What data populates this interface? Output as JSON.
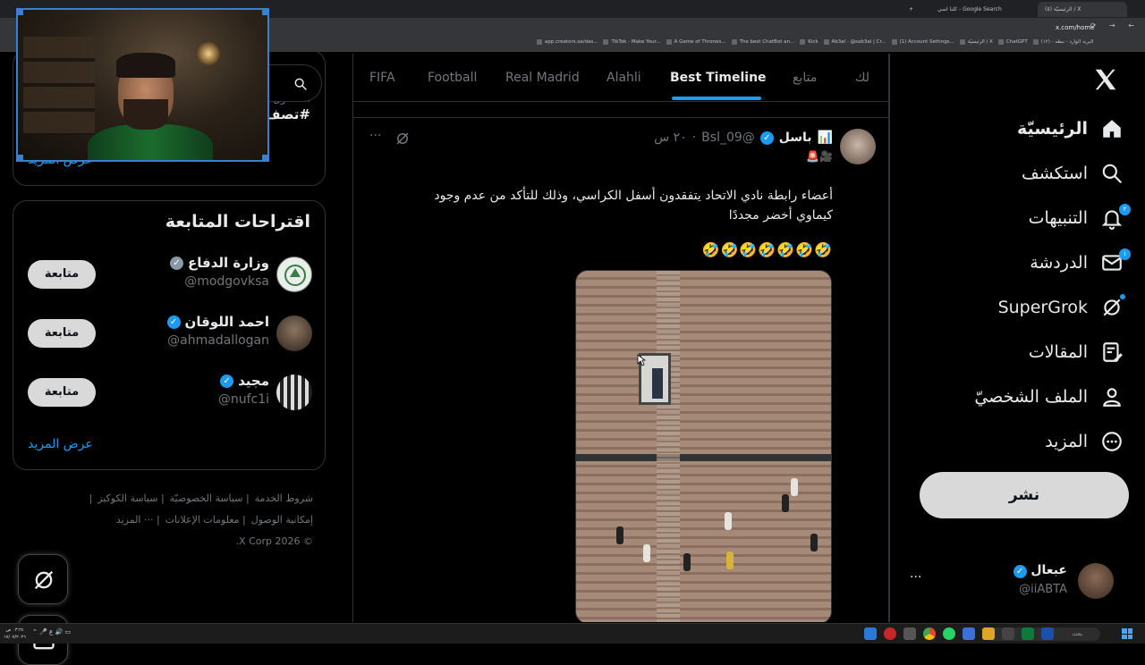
{
  "browser": {
    "tabs": [
      {
        "label": "(٥) الرئيسيّة / X"
      },
      {
        "label": "كلنا اسي - Google Search"
      }
    ],
    "url": "x.com/home",
    "bookmarks": [
      "البريد الوارد - نبطه - (١٢)",
      "ChatGPT",
      "الرئيسيّة / X",
      "(1) Account Settings...",
      "Ab3al - @sab3al | Cr...",
      "Kick",
      "The best ChatBot an...",
      "A Game of Thrones...",
      "TikTok - Make Your...",
      "app.creators.sa/das..."
    ]
  },
  "nav": {
    "items": [
      {
        "label": "الرئيسيّة",
        "icon": "home-icon",
        "active": true
      },
      {
        "label": "استكشف",
        "icon": "search-icon"
      },
      {
        "label": "التنبيهات",
        "icon": "bell-icon",
        "badge": "٢"
      },
      {
        "label": "الدردشة",
        "icon": "mail-icon",
        "badge": "١"
      },
      {
        "label": "SuperGrok",
        "icon": "grok-icon"
      },
      {
        "label": "المقالات",
        "icon": "article-icon"
      },
      {
        "label": "الملف الشخصيّ",
        "icon": "person-icon"
      },
      {
        "label": "المزيد",
        "icon": "more-circle-icon"
      }
    ],
    "post_label": "نشر",
    "account": {
      "name": "عبعال",
      "handle": "@iiABTA",
      "more": "···"
    }
  },
  "timeline": {
    "tabs": [
      {
        "label": "لك"
      },
      {
        "label": "متابع"
      },
      {
        "label": "Best Timeline",
        "active": true
      },
      {
        "label": "Alahli"
      },
      {
        "label": "Real Madrid"
      },
      {
        "label": "Football"
      },
      {
        "label": "FIFA"
      }
    ],
    "tweet": {
      "name": "باسل",
      "name_emoji": "📊",
      "handle": "@Bsl_09",
      "time": "٢٠ س",
      "emoji_row": "🚨🎥",
      "text": "أعضاء رابطة نادي الاتحاد يتفقدون أسفل الكراسي، وذلك للتأكد من عدم وجود كيماوي أخضر مجددًا",
      "emojis": "🤣🤣🤣🤣🤣🤣🤣",
      "more": "···"
    }
  },
  "sidebar": {
    "trend_label": "المتداول",
    "trend_hashtag": "#تصف",
    "trend_more": "عرض المزيد",
    "follow_title": "اقتراحات المتابعة",
    "suggestions": [
      {
        "name": "وزارة الدفاع",
        "handle": "@modgovksa",
        "button": "متابعة",
        "verified": "gray"
      },
      {
        "name": "احمد اللوقان",
        "handle": "@ahmadallogan",
        "button": "متابعة",
        "verified": "blue"
      },
      {
        "name": "مجيد",
        "handle": "@nufc1i",
        "button": "متابعة",
        "verified": "blue"
      }
    ],
    "follow_more": "عرض المزيد",
    "footer": {
      "line1": [
        "شروط الخدمة",
        "سياسة الخصوصيّة",
        "سياسة الكوكيز"
      ],
      "line2": [
        "إمكانية الوصول",
        "معلومات الإعلانات",
        "··· المزيد"
      ],
      "copyright": "© 2026 X Corp."
    }
  },
  "taskbar": {
    "search_placeholder": "بحث",
    "clock_time": "٠٣:٢٤ ص",
    "clock_date": "١٧/٠٧/٢٠٢٦"
  },
  "colors": {
    "accent": "#1d9bf0",
    "background": "#000000",
    "muted": "#71767b",
    "border": "#2f3336"
  }
}
